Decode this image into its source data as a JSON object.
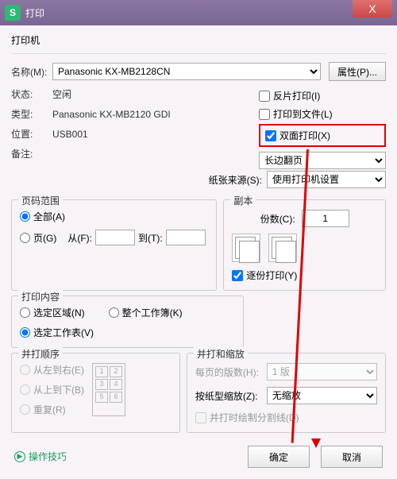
{
  "window": {
    "title": "打印",
    "logo": "S",
    "close": "X"
  },
  "printer": {
    "section": "打印机",
    "name_lbl": "名称(M):",
    "name_val": "Panasonic KX-MB2128CN",
    "props_btn": "属性(P)...",
    "status_lbl": "状态:",
    "status_val": "空闲",
    "type_lbl": "类型:",
    "type_val": "Panasonic KX-MB2120 GDI",
    "loc_lbl": "位置:",
    "loc_val": "USB001",
    "notes_lbl": "备注:",
    "reverse": "反片打印(I)",
    "tofile": "打印到文件(L)",
    "duplex": "双面打印(X)",
    "duplex_opt": "长边翻页",
    "source_lbl": "纸张来源(S):",
    "source_val": "使用打印机设置"
  },
  "range": {
    "title": "页码范围",
    "all": "全部(A)",
    "pages": "页(G)",
    "from": "从(F):",
    "to": "到(T):"
  },
  "copies": {
    "title": "副本",
    "count": "份数(C):",
    "count_val": "1",
    "collate": "逐份打印(Y)"
  },
  "what": {
    "title": "打印内容",
    "sel": "选定区域(N)",
    "wb": "整个工作簿(K)",
    "sheet": "选定工作表(V)"
  },
  "order": {
    "title": "并打顺序",
    "lr": "从左到右(E)",
    "tb": "从上到下(B)",
    "rep": "重复(R)"
  },
  "scale": {
    "title": "并打和缩放",
    "perpage": "每页的版数(H):",
    "perpage_val": "1 版",
    "scaling": "按纸型缩放(Z):",
    "scaling_val": "无缩放",
    "lines": "并打时绘制分割线(D)"
  },
  "tips": "操作技巧",
  "ok": "确定",
  "cancel": "取消",
  "page_nums": [
    "1",
    "2",
    "3",
    "4",
    "5",
    "6"
  ]
}
